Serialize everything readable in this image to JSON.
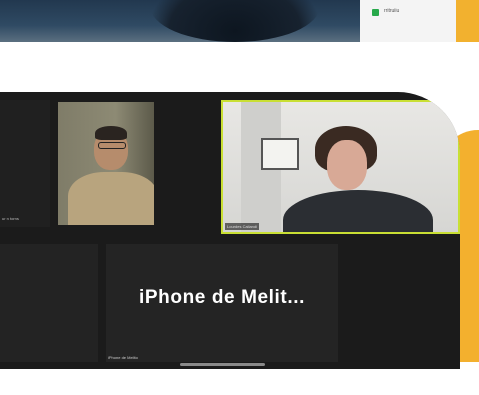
{
  "top_strip": {
    "chat_text": "rritruiiu"
  },
  "zoom": {
    "left_tile_label": "ur n torns",
    "man_tile_label": "",
    "woman_tile_label": "Lourdes Caliandi",
    "iphone_title": "iPhone de Melit...",
    "iphone_label": "iPhone de Melito"
  },
  "colors": {
    "accent_yellow": "#f3b02e",
    "active_speaker_border": "#c9df34",
    "window_bg": "#1b1b1b"
  }
}
